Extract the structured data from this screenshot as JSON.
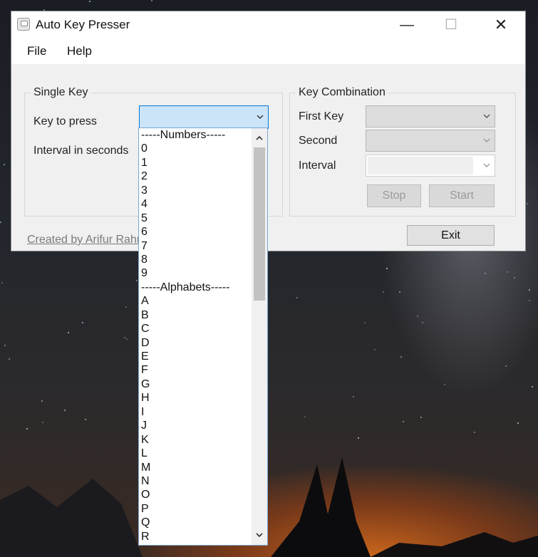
{
  "window": {
    "title": "Auto Key Presser",
    "controls": {
      "minimize": "—",
      "maximize": "☐",
      "close": "✕"
    }
  },
  "menu": [
    "File",
    "Help"
  ],
  "single_key": {
    "title": "Single Key",
    "key_label": "Key to press",
    "interval_label": "Interval in seconds"
  },
  "key_combination": {
    "title": "Key Combination",
    "first_key_label": "First Key",
    "second_label": "Second",
    "interval_label": "Interval",
    "stop_label": "Stop",
    "start_label": "Start"
  },
  "exit_label": "Exit",
  "credit": "Created by Arifur Rahm",
  "dropdown": {
    "items": [
      "-----Numbers-----",
      "0",
      "1",
      "2",
      "3",
      "4",
      "5",
      "6",
      "7",
      "8",
      "9",
      "-----Alphabets-----",
      "A",
      "B",
      "C",
      "D",
      "E",
      "F",
      "G",
      "H",
      "I",
      "J",
      "K",
      "L",
      "M",
      "N",
      "O",
      "P",
      "Q",
      "R"
    ]
  }
}
